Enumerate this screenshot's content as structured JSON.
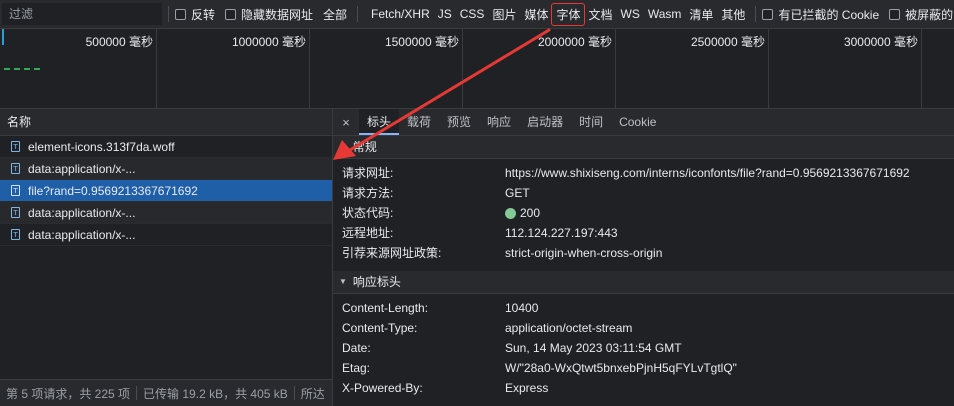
{
  "toolbar": {
    "filter_placeholder": "过滤",
    "invert_label": "反转",
    "hide_data_urls_label": "隐藏数据网址",
    "all_label": "全部",
    "type_filters": [
      "Fetch/XHR",
      "JS",
      "CSS",
      "图片",
      "媒体",
      "字体",
      "文档",
      "WS",
      "Wasm",
      "清单",
      "其他"
    ],
    "highlighted_filter": "字体",
    "blocked_cookies_label": "有已拦截的 Cookie",
    "blocked_requests_label": "被屏蔽的"
  },
  "timeline": {
    "ticks": [
      "500000 毫秒",
      "1000000 毫秒",
      "1500000 毫秒",
      "2000000 毫秒",
      "2500000 毫秒",
      "3000000 毫秒"
    ]
  },
  "request_list": {
    "column_header": "名称",
    "rows": [
      {
        "name": "element-icons.313f7da.woff"
      },
      {
        "name": "data:application/x-..."
      },
      {
        "name": "file?rand=0.9569213367671692"
      },
      {
        "name": "data:application/x-..."
      },
      {
        "name": "data:application/x-..."
      }
    ],
    "selected_index": 2
  },
  "status_bar": {
    "requests": "第 5 项请求，共 225 项",
    "transferred": "已传输 19.2 kB，共 405 kB",
    "resources": "所达"
  },
  "details": {
    "close_symbol": "×",
    "tabs": [
      "标头",
      "载荷",
      "预览",
      "响应",
      "启动器",
      "时间",
      "Cookie"
    ],
    "active_tab": "标头",
    "general": {
      "title": "常规",
      "rows": [
        {
          "key": "请求网址:",
          "value": "https://www.shixiseng.com/interns/iconfonts/file?rand=0.9569213367671692"
        },
        {
          "key": "请求方法:",
          "value": "GET"
        },
        {
          "key": "状态代码:",
          "value": "200"
        },
        {
          "key": "远程地址:",
          "value": "112.124.227.197:443"
        },
        {
          "key": "引荐来源网址政策:",
          "value": "strict-origin-when-cross-origin"
        }
      ]
    },
    "response_headers": {
      "title": "响应标头",
      "rows": [
        {
          "key": "Content-Length:",
          "value": "10400"
        },
        {
          "key": "Content-Type:",
          "value": "application/octet-stream"
        },
        {
          "key": "Date:",
          "value": "Sun, 14 May 2023 03:11:54 GMT"
        },
        {
          "key": "Etag:",
          "value": "W/\"28a0-WxQtwt5bnxebPjnH5qFYLvTgtlQ\""
        },
        {
          "key": "X-Powered-By:",
          "value": "Express"
        }
      ]
    }
  },
  "colors": {
    "background": "#202124",
    "toolbar": "#292a2d",
    "selected_row": "#1f5fa8",
    "status_ok": "#81c995",
    "annotation": "#e53935"
  }
}
